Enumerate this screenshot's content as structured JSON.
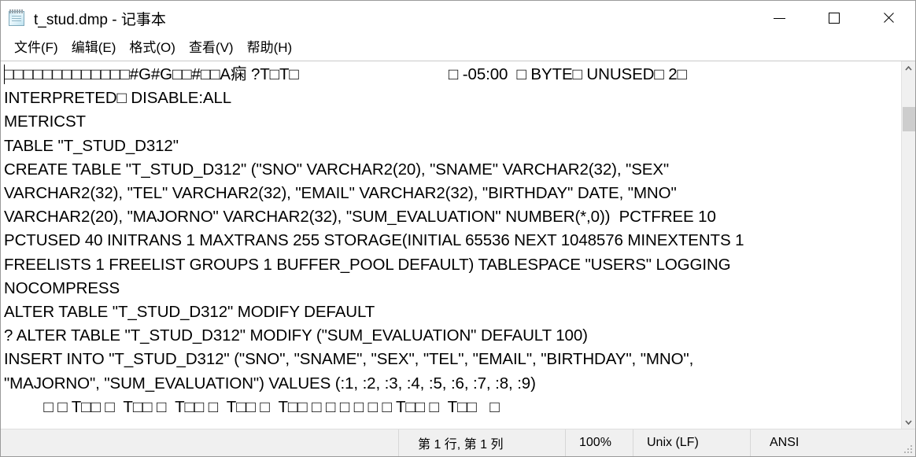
{
  "window": {
    "title": "t_stud.dmp - 记事本",
    "icon": "notepad-icon",
    "controls": {
      "minimize": "—",
      "maximize": "□",
      "close": "✕"
    }
  },
  "menubar": {
    "items": [
      {
        "label": "文件(F)",
        "name": "menu-file"
      },
      {
        "label": "编辑(E)",
        "name": "menu-edit"
      },
      {
        "label": "格式(O)",
        "name": "menu-format"
      },
      {
        "label": "查看(V)",
        "name": "menu-view"
      },
      {
        "label": "帮助(H)",
        "name": "menu-help"
      }
    ]
  },
  "editor": {
    "lines": [
      "□□□□□□□□□□□□□#G#G□□#□□A痫 ?T□T□                                  □ -05:00  □ BYTE□ UNUSED□ 2□",
      "INTERPRETED□ DISABLE:ALL",
      "METRICST",
      "TABLE \"T_STUD_D312\"",
      "CREATE TABLE \"T_STUD_D312\" (\"SNO\" VARCHAR2(20), \"SNAME\" VARCHAR2(32), \"SEX\"",
      "VARCHAR2(32), \"TEL\" VARCHAR2(32), \"EMAIL\" VARCHAR2(32), \"BIRTHDAY\" DATE, \"MNO\"",
      "VARCHAR2(20), \"MAJORNO\" VARCHAR2(32), \"SUM_EVALUATION\" NUMBER(*,0))  PCTFREE 10",
      "PCTUSED 40 INITRANS 1 MAXTRANS 255 STORAGE(INITIAL 65536 NEXT 1048576 MINEXTENTS 1",
      "FREELISTS 1 FREELIST GROUPS 1 BUFFER_POOL DEFAULT) TABLESPACE \"USERS\" LOGGING",
      "NOCOMPRESS",
      "ALTER TABLE \"T_STUD_D312\" MODIFY DEFAULT",
      "? ALTER TABLE \"T_STUD_D312\" MODIFY (\"SUM_EVALUATION\" DEFAULT 100)",
      "INSERT INTO \"T_STUD_D312\" (\"SNO\", \"SNAME\", \"SEX\", \"TEL\", \"EMAIL\", \"BIRTHDAY\", \"MNO\",",
      "\"MAJORNO\", \"SUM_EVALUATION\") VALUES (:1, :2, :3, :4, :5, :6, :7, :8, :9)",
      "         □ □ T□□ □  T□□ □  T□□ □  T□□ □  T□□ □ □ □ □ □ □ T□□ □  T□□   □"
    ]
  },
  "scrollbar": {
    "up_arrow": "scroll-up-icon",
    "down_arrow": "scroll-down-icon",
    "thumb": "scroll-thumb"
  },
  "statusbar": {
    "position": "第 1 行, 第 1 列",
    "zoom": "100%",
    "line_ending": "Unix (LF)",
    "encoding": "ANSI"
  },
  "colors": {
    "window_bg": "#ffffff",
    "statusbar_bg": "#f0f0f0",
    "scrollbar_track": "#f0f0f0",
    "scrollbar_thumb": "#cdcdcd",
    "text": "#000000",
    "close_hover": "#e81123"
  }
}
